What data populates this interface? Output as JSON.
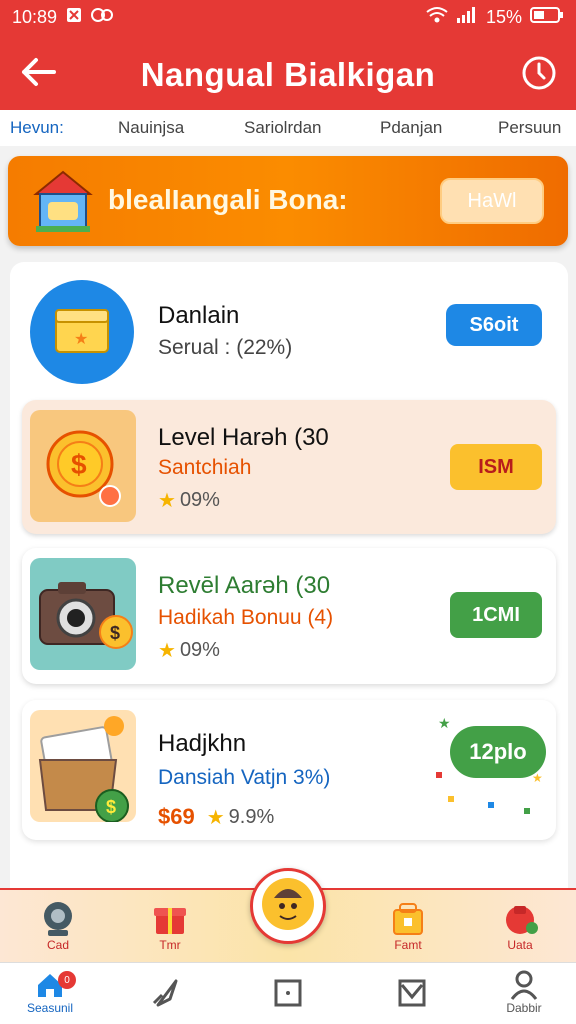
{
  "status_bar": {
    "time": "10:89",
    "right_text": "15%",
    "left_icons": [
      "notification-icon",
      "alarm-icon"
    ],
    "right_icons": [
      "wifi-icon",
      "signal-icon",
      "battery-icon"
    ]
  },
  "app_bar": {
    "title": "Nangual Bialkigan",
    "back_icon": "arrow-left-icon",
    "history_icon": "history-icon"
  },
  "tabs": [
    "Hevun:",
    "Nauinjsa",
    "Sariolrdan",
    "Pdanjan",
    "Persuun"
  ],
  "banner": {
    "text": "blealIangali Bona:",
    "button_label": "HaWl",
    "icon": "house-gift-icon"
  },
  "items": [
    {
      "title": "Danlain",
      "subtitle": "Serual : (22%)",
      "button_label": "S6oit",
      "icon": "treasure-box-icon"
    },
    {
      "title": "Level Harǝh (30",
      "subtitle": "Santchiah",
      "meta": "09%",
      "button_label": "ISM",
      "icon": "gold-coin-icon"
    },
    {
      "title": "Revēl Aarǝh (30",
      "subtitle": "Hadikah Bonuu (4)",
      "meta": "09%",
      "button_label": "1CMI",
      "icon": "camera-coin-icon"
    },
    {
      "title": "Hadjkhn",
      "subtitle": "Dansiah Vatjn 3%)",
      "price": "$69",
      "meta": "9.9%",
      "button_label": "12plo",
      "icon": "mail-basket-icon"
    }
  ],
  "bottom_sheet": [
    {
      "label": "Cad",
      "icon": "robot-icon"
    },
    {
      "label": "Tmr",
      "icon": "gift-icon"
    },
    {
      "label": "",
      "icon": "mascot-icon"
    },
    {
      "label": "Famt",
      "icon": "lock-box-icon"
    },
    {
      "label": "Uata",
      "icon": "cart-icon"
    }
  ],
  "nav": [
    {
      "label": "Seasunil",
      "icon": "home-icon",
      "badge": "0"
    },
    {
      "label": "",
      "icon": "rocket-icon"
    },
    {
      "label": "",
      "icon": "square-icon"
    },
    {
      "label": "",
      "icon": "image-icon"
    },
    {
      "label": "Dabbir",
      "icon": "person-icon"
    }
  ],
  "colors": {
    "primary": "#e53935",
    "orange": "#f57c00",
    "blue": "#1e88e5",
    "yellow": "#fbc02d",
    "green": "#43a047"
  }
}
